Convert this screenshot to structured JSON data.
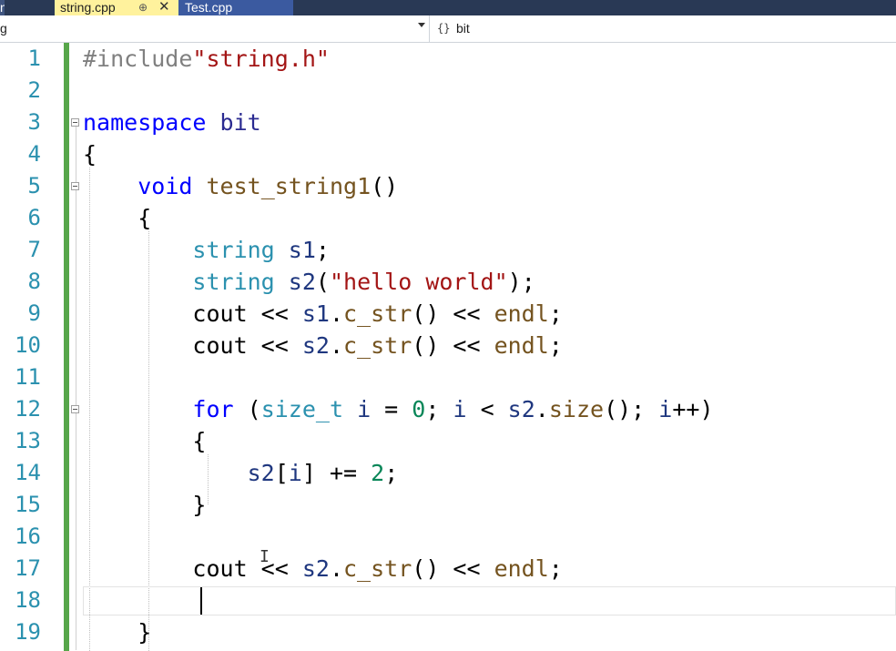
{
  "tabs": {
    "left_partial": "n",
    "active": {
      "label": "string.cpp",
      "pin": "⊕",
      "close": "✕"
    },
    "inactive": {
      "label": "Test.cpp"
    }
  },
  "navbar": {
    "scope_left": "g",
    "scope_right_icon": "{}",
    "scope_right": "bit"
  },
  "editor": {
    "line_numbers": [
      "1",
      "2",
      "3",
      "4",
      "5",
      "6",
      "7",
      "8",
      "9",
      "10",
      "11",
      "12",
      "13",
      "14",
      "15",
      "16",
      "17",
      "18",
      "19"
    ],
    "lines": [
      [
        {
          "t": "#include",
          "c": "pre"
        },
        {
          "t": "\"string.h\"",
          "c": "str"
        }
      ],
      [],
      [
        {
          "t": "namespace",
          "c": "kw"
        },
        {
          "t": " bit",
          "c": "ns"
        }
      ],
      [
        {
          "t": "{",
          "c": ""
        }
      ],
      [
        {
          "t": "    ",
          "c": ""
        },
        {
          "t": "void",
          "c": "kw"
        },
        {
          "t": " ",
          "c": ""
        },
        {
          "t": "test_string1",
          "c": "fn"
        },
        {
          "t": "()",
          "c": ""
        }
      ],
      [
        {
          "t": "    {",
          "c": ""
        }
      ],
      [
        {
          "t": "        ",
          "c": ""
        },
        {
          "t": "string",
          "c": "type"
        },
        {
          "t": " ",
          "c": ""
        },
        {
          "t": "s1",
          "c": "var"
        },
        {
          "t": ";",
          "c": ""
        }
      ],
      [
        {
          "t": "        ",
          "c": ""
        },
        {
          "t": "string",
          "c": "type"
        },
        {
          "t": " ",
          "c": ""
        },
        {
          "t": "s2",
          "c": "var"
        },
        {
          "t": "(",
          "c": ""
        },
        {
          "t": "\"hello world\"",
          "c": "str"
        },
        {
          "t": ");",
          "c": ""
        }
      ],
      [
        {
          "t": "        cout << ",
          "c": ""
        },
        {
          "t": "s1",
          "c": "var"
        },
        {
          "t": ".",
          "c": ""
        },
        {
          "t": "c_str",
          "c": "fn"
        },
        {
          "t": "() << ",
          "c": ""
        },
        {
          "t": "endl",
          "c": "fn"
        },
        {
          "t": ";",
          "c": ""
        }
      ],
      [
        {
          "t": "        cout << ",
          "c": ""
        },
        {
          "t": "s2",
          "c": "var"
        },
        {
          "t": ".",
          "c": ""
        },
        {
          "t": "c_str",
          "c": "fn"
        },
        {
          "t": "() << ",
          "c": ""
        },
        {
          "t": "endl",
          "c": "fn"
        },
        {
          "t": ";",
          "c": ""
        }
      ],
      [],
      [
        {
          "t": "        ",
          "c": ""
        },
        {
          "t": "for",
          "c": "kw"
        },
        {
          "t": " (",
          "c": ""
        },
        {
          "t": "size_t",
          "c": "type"
        },
        {
          "t": " ",
          "c": ""
        },
        {
          "t": "i",
          "c": "var"
        },
        {
          "t": " = ",
          "c": ""
        },
        {
          "t": "0",
          "c": "num"
        },
        {
          "t": "; ",
          "c": ""
        },
        {
          "t": "i",
          "c": "var"
        },
        {
          "t": " < ",
          "c": ""
        },
        {
          "t": "s2",
          "c": "var"
        },
        {
          "t": ".",
          "c": ""
        },
        {
          "t": "size",
          "c": "fn"
        },
        {
          "t": "(); ",
          "c": ""
        },
        {
          "t": "i",
          "c": "var"
        },
        {
          "t": "++)",
          "c": ""
        }
      ],
      [
        {
          "t": "        {",
          "c": ""
        }
      ],
      [
        {
          "t": "            ",
          "c": ""
        },
        {
          "t": "s2",
          "c": "var"
        },
        {
          "t": "[",
          "c": ""
        },
        {
          "t": "i",
          "c": "var"
        },
        {
          "t": "] += ",
          "c": ""
        },
        {
          "t": "2",
          "c": "num"
        },
        {
          "t": ";",
          "c": ""
        }
      ],
      [
        {
          "t": "        }",
          "c": ""
        }
      ],
      [],
      [
        {
          "t": "        cout << ",
          "c": ""
        },
        {
          "t": "s2",
          "c": "var"
        },
        {
          "t": ".",
          "c": ""
        },
        {
          "t": "c_str",
          "c": "fn"
        },
        {
          "t": "() << ",
          "c": ""
        },
        {
          "t": "endl",
          "c": "fn"
        },
        {
          "t": ";",
          "c": ""
        }
      ],
      [],
      [
        {
          "t": "    }",
          "c": ""
        }
      ]
    ]
  }
}
